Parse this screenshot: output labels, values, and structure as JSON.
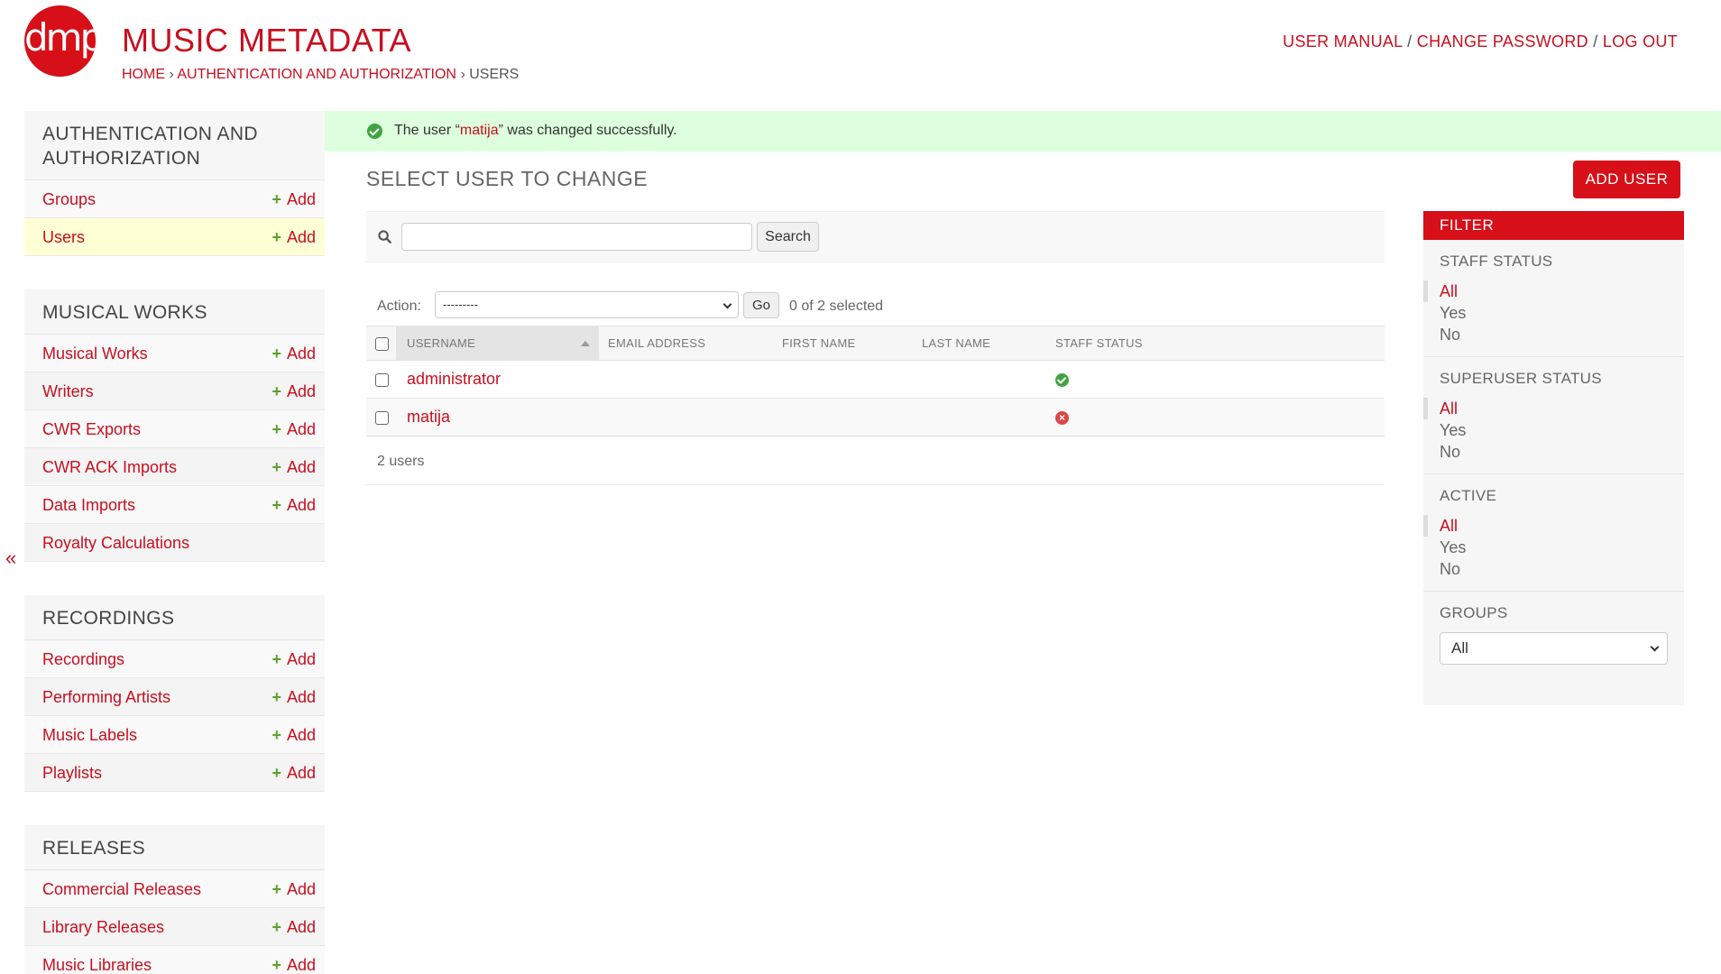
{
  "header": {
    "logo_text": "dmp",
    "site_title": "MUSIC METADATA",
    "breadcrumbs": {
      "home": "HOME",
      "app": "AUTHENTICATION AND AUTHORIZATION",
      "sep": "›",
      "current": "USERS"
    },
    "user_tools": {
      "manual": "USER MANUAL",
      "change_password": "CHANGE PASSWORD",
      "logout": "LOG OUT",
      "sep": "/"
    }
  },
  "sidebar": {
    "collapse_label": "«",
    "add_label": "Add",
    "modules": [
      {
        "caption": "AUTHENTICATION AND AUTHORIZATION",
        "items": [
          {
            "label": "Groups",
            "add": true
          },
          {
            "label": "Users",
            "add": true,
            "current": true
          }
        ]
      },
      {
        "caption": "MUSICAL WORKS",
        "items": [
          {
            "label": "Musical Works",
            "add": true
          },
          {
            "label": "Writers",
            "add": true
          },
          {
            "label": "CWR Exports",
            "add": true
          },
          {
            "label": "CWR ACK Imports",
            "add": true
          },
          {
            "label": "Data Imports",
            "add": true
          },
          {
            "label": "Royalty Calculations",
            "add": false
          }
        ]
      },
      {
        "caption": "RECORDINGS",
        "items": [
          {
            "label": "Recordings",
            "add": true
          },
          {
            "label": "Performing Artists",
            "add": true
          },
          {
            "label": "Music Labels",
            "add": true
          },
          {
            "label": "Playlists",
            "add": true
          }
        ]
      },
      {
        "caption": "RELEASES",
        "items": [
          {
            "label": "Commercial Releases",
            "add": true
          },
          {
            "label": "Library Releases",
            "add": true
          },
          {
            "label": "Music Libraries",
            "add": true
          }
        ]
      }
    ]
  },
  "message": {
    "prefix": "The user “",
    "user": "matija",
    "suffix": "” was changed successfully."
  },
  "main": {
    "heading": "SELECT USER TO CHANGE",
    "add_button": "ADD USER",
    "search": {
      "value": "",
      "button": "Search"
    },
    "actions": {
      "label": "Action:",
      "selected": "---------",
      "go": "Go",
      "counter": "0 of 2 selected"
    },
    "table": {
      "columns": [
        "USERNAME",
        "EMAIL ADDRESS",
        "FIRST NAME",
        "LAST NAME",
        "STAFF STATUS"
      ],
      "rows": [
        {
          "username": "administrator",
          "email": "",
          "first_name": "",
          "last_name": "",
          "staff_status": true
        },
        {
          "username": "matija",
          "email": "",
          "first_name": "",
          "last_name": "",
          "staff_status": false
        }
      ]
    },
    "paginator": "2 users"
  },
  "filter": {
    "title": "FILTER",
    "sections": [
      {
        "title": "STAFF STATUS",
        "options": [
          "All",
          "Yes",
          "No"
        ],
        "selected": "All"
      },
      {
        "title": "SUPERUSER STATUS",
        "options": [
          "All",
          "Yes",
          "No"
        ],
        "selected": "All"
      },
      {
        "title": "ACTIVE",
        "options": [
          "All",
          "Yes",
          "No"
        ],
        "selected": "All"
      }
    ],
    "groups": {
      "title": "GROUPS",
      "selected": "All"
    }
  },
  "colors": {
    "brand": "#c70f1f",
    "brand_button": "#d60f19",
    "success_bg": "#ddffdd",
    "current_row": "#ffffd6",
    "add_plus": "#5aa02c"
  }
}
